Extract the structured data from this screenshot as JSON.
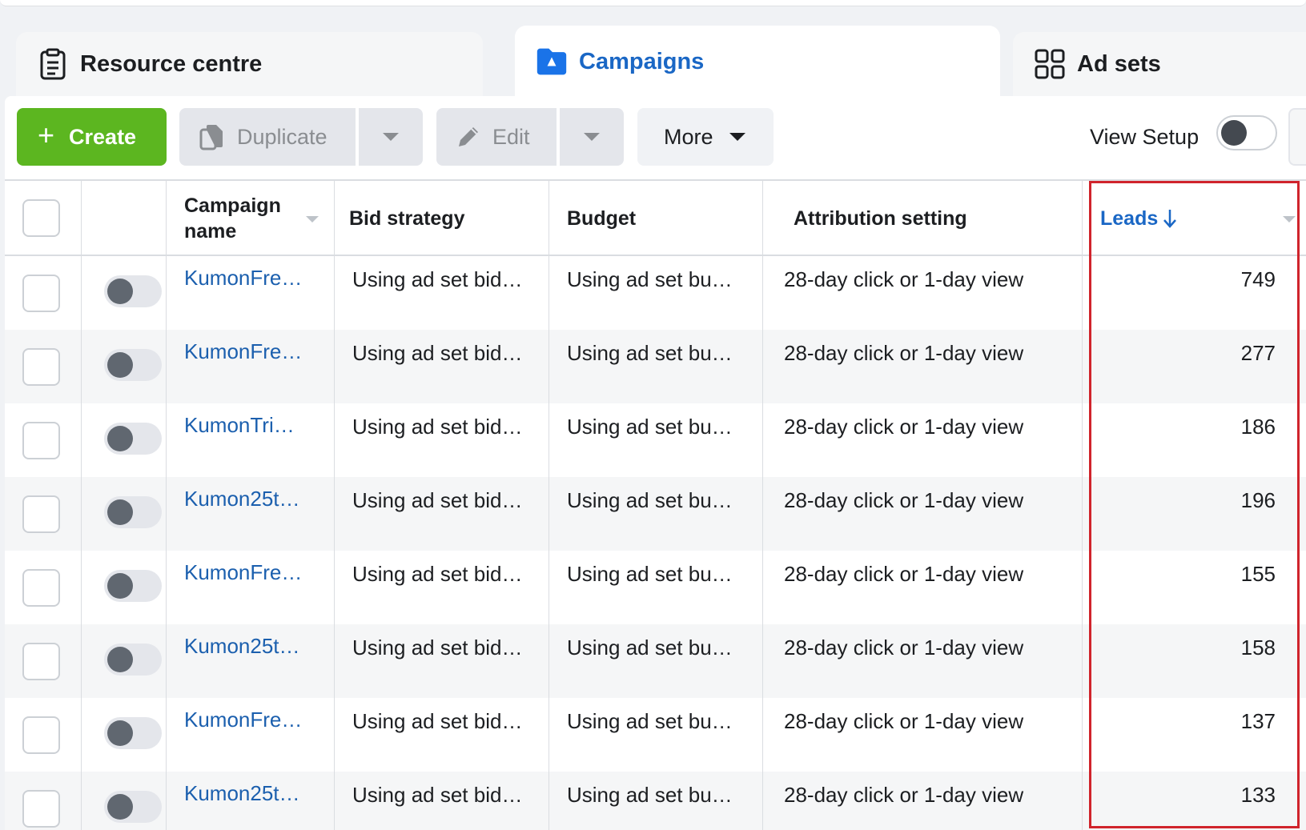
{
  "tabs": [
    {
      "label": "Resource centre",
      "icon": "clipboard-icon",
      "active": false
    },
    {
      "label": "Campaigns",
      "icon": "campaign-folder-icon",
      "active": true
    },
    {
      "label": "Ad sets",
      "icon": "grid-icon",
      "active": false
    }
  ],
  "toolbar": {
    "create_label": "Create",
    "duplicate_label": "Duplicate",
    "edit_label": "Edit",
    "more_label": "More",
    "view_setup_label": "View Setup"
  },
  "table": {
    "headers": {
      "campaign_name": "Campaign name",
      "bid_strategy": "Bid strategy",
      "budget": "Budget",
      "attribution_setting": "Attribution setting",
      "leads": "Leads"
    },
    "rows": [
      {
        "name": "KumonFre…",
        "bid": "Using ad set bid…",
        "budget": "Using ad set bu…",
        "attribution": "28-day click or 1-day view",
        "leads": "749"
      },
      {
        "name": "KumonFre…",
        "bid": "Using ad set bid…",
        "budget": "Using ad set bu…",
        "attribution": "28-day click or 1-day view",
        "leads": "277"
      },
      {
        "name": "KumonTri…",
        "bid": "Using ad set bid…",
        "budget": "Using ad set bu…",
        "attribution": "28-day click or 1-day view",
        "leads": "186"
      },
      {
        "name": "Kumon25t…",
        "bid": "Using ad set bid…",
        "budget": "Using ad set bu…",
        "attribution": "28-day click or 1-day view",
        "leads": "196"
      },
      {
        "name": "KumonFre…",
        "bid": "Using ad set bid…",
        "budget": "Using ad set bu…",
        "attribution": "28-day click or 1-day view",
        "leads": "155"
      },
      {
        "name": "Kumon25t…",
        "bid": "Using ad set bid…",
        "budget": "Using ad set bu…",
        "attribution": "28-day click or 1-day view",
        "leads": "158"
      },
      {
        "name": "KumonFre…",
        "bid": "Using ad set bid…",
        "budget": "Using ad set bu…",
        "attribution": "28-day click or 1-day view",
        "leads": "137"
      },
      {
        "name": "Kumon25t…",
        "bid": "Using ad set bid…",
        "budget": "Using ad set bu…",
        "attribution": "28-day click or 1-day view",
        "leads": "133"
      }
    ]
  },
  "colors": {
    "accent_blue": "#1a67c5",
    "create_green": "#5cb620",
    "highlight_red": "#d0242c"
  }
}
